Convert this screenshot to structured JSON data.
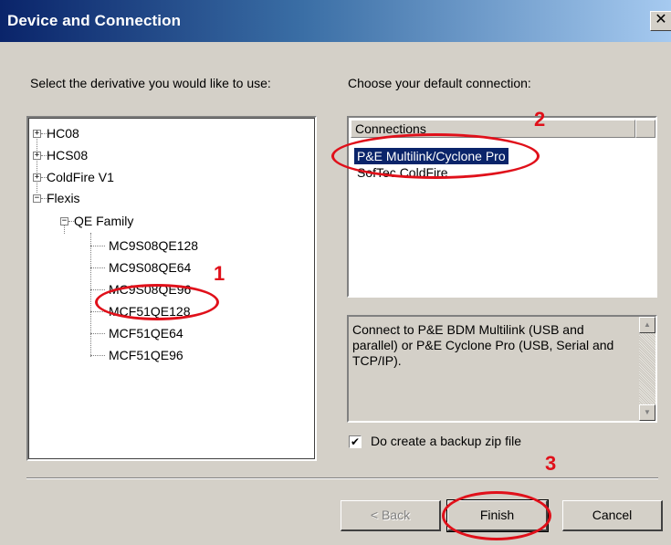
{
  "window": {
    "title": "Device and Connection",
    "close_glyph": "✕"
  },
  "left": {
    "prompt": "Select the derivative you would like to use:",
    "tree": [
      {
        "label": "HC08",
        "expander": "+"
      },
      {
        "label": "HCS08",
        "expander": "+"
      },
      {
        "label": "ColdFire V1",
        "expander": "+"
      },
      {
        "label": "Flexis",
        "expander": "−"
      },
      {
        "label": "QE Family",
        "expander": "−"
      },
      {
        "label": "MC9S08QE128"
      },
      {
        "label": "MC9S08QE64"
      },
      {
        "label": "MC9S08QE96"
      },
      {
        "label": "MCF51QE128"
      },
      {
        "label": "MCF51QE64"
      },
      {
        "label": "MCF51QE96"
      }
    ]
  },
  "right": {
    "prompt": "Choose your default connection:",
    "list_header": "Connections",
    "connections": [
      {
        "label": "P&E Multilink/Cyclone Pro",
        "selected": true
      },
      {
        "label": "SofTec ColdFire",
        "selected": false
      }
    ],
    "description": "Connect to P&E BDM Multilink (USB and parallel) or P&E Cyclone Pro (USB, Serial and TCP/IP).",
    "checkbox": {
      "label": "Do create a backup zip file",
      "checked": true,
      "glyph": "✔"
    }
  },
  "buttons": {
    "back": "< Back",
    "finish": "Finish",
    "cancel": "Cancel"
  },
  "annotations": [
    "1",
    "2",
    "3"
  ],
  "colors": {
    "annotation": "#e0101a",
    "selection": "#0a246a",
    "dialog": "#d4d0c8"
  },
  "icons": {
    "scroll_up": "▲",
    "scroll_down": "▼"
  }
}
